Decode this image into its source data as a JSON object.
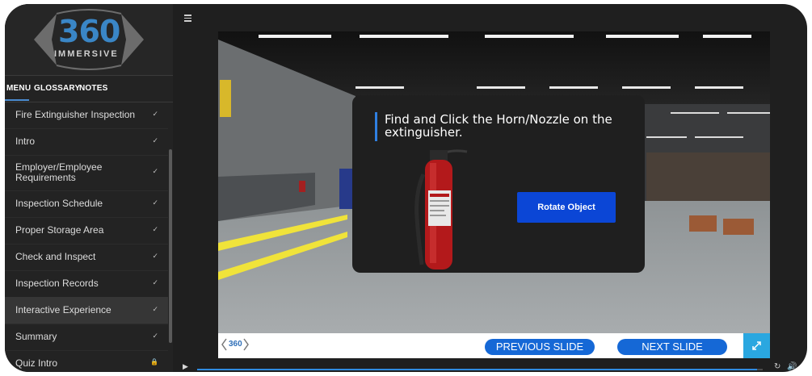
{
  "logo": {
    "number": "360",
    "word": "IMMERSIVE"
  },
  "tabs": {
    "menu": "MENU",
    "glossary": "GLOSSARY",
    "notes": "NOTES"
  },
  "menu": [
    {
      "label": "Fire Extinguisher Inspection",
      "icon": "✓",
      "state": "complete"
    },
    {
      "label": "Intro",
      "icon": "✓",
      "state": "complete"
    },
    {
      "label": "Employer/Employee Requirements",
      "icon": "✓",
      "state": "complete"
    },
    {
      "label": "Inspection Schedule",
      "icon": "✓",
      "state": "complete"
    },
    {
      "label": "Proper Storage Area",
      "icon": "✓",
      "state": "complete"
    },
    {
      "label": "Check and Inspect",
      "icon": "✓",
      "state": "complete"
    },
    {
      "label": "Inspection Records",
      "icon": "✓",
      "state": "complete"
    },
    {
      "label": "Interactive Experience",
      "icon": "✓",
      "state": "current"
    },
    {
      "label": "Summary",
      "icon": "✓",
      "state": "complete"
    },
    {
      "label": "Quiz Intro",
      "icon": "🔒",
      "state": "locked"
    }
  ],
  "dialog": {
    "instruction": "Find and Click the Horn/Nozzle on the extinguisher.",
    "rotate_label": "Rotate Object"
  },
  "footer": {
    "mini_logo": "360",
    "prev_label": "PREVIOUS SLIDE",
    "next_label": "NEXT SLIDE"
  },
  "playback": {
    "progress_fraction": 0.99
  },
  "colors": {
    "accent": "#1568d6",
    "rotate_button": "#0b46d6",
    "fullscreen": "#2aa7e0",
    "extinguisher": "#b3191b"
  }
}
